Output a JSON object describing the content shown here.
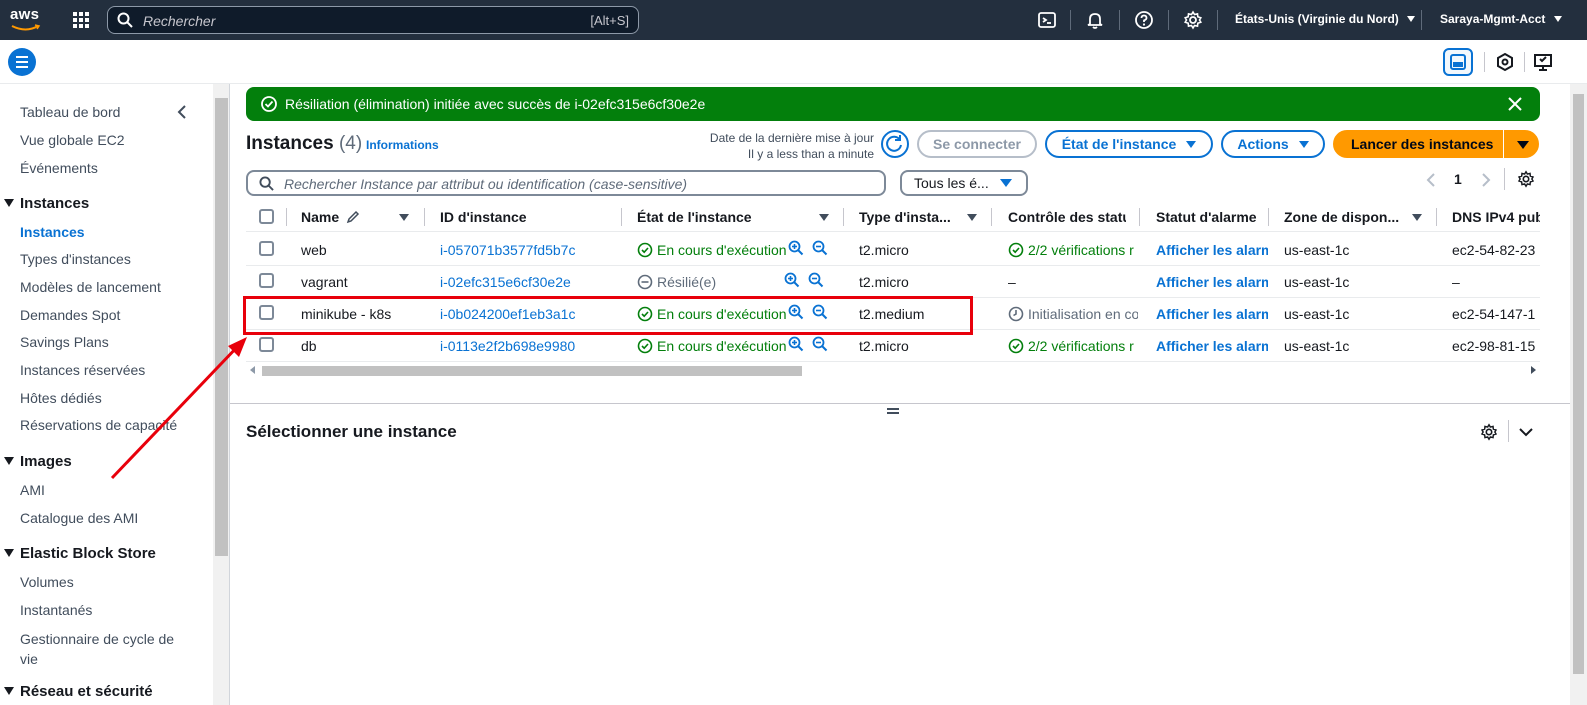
{
  "topnav": {
    "logo": "aws",
    "search_placeholder": "Rechercher",
    "search_shortcut": "[Alt+S]",
    "region": "États-Unis (Virginie du Nord)",
    "account": "Saraya-Mgmt-Acct",
    "icons": [
      "cloudshell-icon",
      "bell-icon",
      "help-icon",
      "gear-icon"
    ]
  },
  "sidebar": {
    "items": [
      {
        "label": "Tableau de bord"
      },
      {
        "label": "Vue globale EC2"
      },
      {
        "label": "Événements"
      }
    ],
    "sections": [
      {
        "title": "Instances",
        "items": [
          "Instances",
          "Types d'instances",
          "Modèles de lancement",
          "Demandes Spot",
          "Savings Plans",
          "Instances réservées",
          "Hôtes dédiés",
          "Réservations de capacité"
        ]
      },
      {
        "title": "Images",
        "items": [
          "AMI",
          "Catalogue des AMI"
        ]
      },
      {
        "title": "Elastic Block Store",
        "items": [
          "Volumes",
          "Instantanés",
          "Gestionnaire de cycle de vie"
        ]
      },
      {
        "title": "Réseau et sécurité",
        "items": []
      }
    ],
    "active": "Instances"
  },
  "flash": {
    "message": "Résiliation (élimination) initiée avec succès de i-02efc315e6cf30e2e",
    "color": "#037f0c"
  },
  "header": {
    "title": "Instances",
    "count": "(4)",
    "info_link": "Informations",
    "last_update_label": "Date de la dernière mise à jour",
    "last_update_value": "Il y a less than a minute",
    "connect_button": "Se connecter",
    "state_button": "État de l'instance",
    "actions_button": "Actions",
    "launch_button": "Lancer des instances"
  },
  "filter": {
    "placeholder": "Rechercher Instance par attribut ou identification (case-sensitive)",
    "states_select": "Tous les é...",
    "page": "1"
  },
  "table": {
    "columns": [
      "Name",
      "ID d'instance",
      "État de l'instance",
      "Type d'insta...",
      "Contrôle des statu",
      "Statut d'alarme",
      "Zone de dispon...",
      "DNS IPv4 pub"
    ],
    "rows": [
      {
        "name": "web",
        "id": "i-057071b3577fd5b7c",
        "state": "En cours d'exécution",
        "state_kind": "running",
        "type": "t2.micro",
        "check": "2/2 vérifications r",
        "check_kind": "ok",
        "alarm": "Afficher les alarm",
        "zone": "us-east-1c",
        "dns": "ec2-54-82-23"
      },
      {
        "name": "vagrant",
        "id": "i-02efc315e6cf30e2e",
        "state": "Résilié(e)",
        "state_kind": "terminated",
        "type": "t2.micro",
        "check": "–",
        "check_kind": "none",
        "alarm": "Afficher les alarm",
        "zone": "us-east-1c",
        "dns": "–"
      },
      {
        "name": "minikube - k8s",
        "id": "i-0b024200ef1eb3a1c",
        "state": "En cours d'exécution",
        "state_kind": "running",
        "type": "t2.medium",
        "check": "Initialisation en co",
        "check_kind": "pending",
        "alarm": "Afficher les alarm",
        "zone": "us-east-1c",
        "dns": "ec2-54-147-1"
      },
      {
        "name": "db",
        "id": "i-0113e2f2b698e9980",
        "state": "En cours d'exécution",
        "state_kind": "running",
        "type": "t2.micro",
        "check": "2/2 vérifications r",
        "check_kind": "ok",
        "alarm": "Afficher les alarm",
        "zone": "us-east-1c",
        "dns": "ec2-98-81-15"
      }
    ]
  },
  "details": {
    "title": "Sélectionner une instance"
  },
  "annotation": {
    "highlight_color": "#e8000b"
  }
}
